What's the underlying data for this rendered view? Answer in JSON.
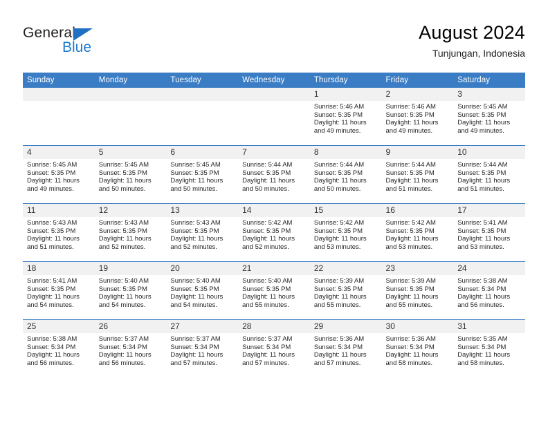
{
  "brand": {
    "name_part1": "General",
    "name_part2": "Blue",
    "accent_color": "#1f7bd0",
    "triangle_color": "#1f6fc4"
  },
  "header": {
    "title": "August 2024",
    "subtitle": "Tunjungan, Indonesia"
  },
  "theme": {
    "header_row_color": "#3b7dc4",
    "daynum_band_color": "#f1f1f1",
    "text_color": "#262626"
  },
  "weekday_headers": [
    "Sunday",
    "Monday",
    "Tuesday",
    "Wednesday",
    "Thursday",
    "Friday",
    "Saturday"
  ],
  "weeks": [
    [
      {
        "day": "",
        "sunrise": "",
        "sunset": "",
        "daylight_line1": "",
        "daylight_line2": "",
        "empty": true
      },
      {
        "day": "",
        "sunrise": "",
        "sunset": "",
        "daylight_line1": "",
        "daylight_line2": "",
        "empty": true
      },
      {
        "day": "",
        "sunrise": "",
        "sunset": "",
        "daylight_line1": "",
        "daylight_line2": "",
        "empty": true
      },
      {
        "day": "",
        "sunrise": "",
        "sunset": "",
        "daylight_line1": "",
        "daylight_line2": "",
        "empty": true
      },
      {
        "day": "1",
        "sunrise": "Sunrise: 5:46 AM",
        "sunset": "Sunset: 5:35 PM",
        "daylight_line1": "Daylight: 11 hours",
        "daylight_line2": "and 49 minutes.",
        "empty": false
      },
      {
        "day": "2",
        "sunrise": "Sunrise: 5:46 AM",
        "sunset": "Sunset: 5:35 PM",
        "daylight_line1": "Daylight: 11 hours",
        "daylight_line2": "and 49 minutes.",
        "empty": false
      },
      {
        "day": "3",
        "sunrise": "Sunrise: 5:45 AM",
        "sunset": "Sunset: 5:35 PM",
        "daylight_line1": "Daylight: 11 hours",
        "daylight_line2": "and 49 minutes.",
        "empty": false
      }
    ],
    [
      {
        "day": "4",
        "sunrise": "Sunrise: 5:45 AM",
        "sunset": "Sunset: 5:35 PM",
        "daylight_line1": "Daylight: 11 hours",
        "daylight_line2": "and 49 minutes.",
        "empty": false
      },
      {
        "day": "5",
        "sunrise": "Sunrise: 5:45 AM",
        "sunset": "Sunset: 5:35 PM",
        "daylight_line1": "Daylight: 11 hours",
        "daylight_line2": "and 50 minutes.",
        "empty": false
      },
      {
        "day": "6",
        "sunrise": "Sunrise: 5:45 AM",
        "sunset": "Sunset: 5:35 PM",
        "daylight_line1": "Daylight: 11 hours",
        "daylight_line2": "and 50 minutes.",
        "empty": false
      },
      {
        "day": "7",
        "sunrise": "Sunrise: 5:44 AM",
        "sunset": "Sunset: 5:35 PM",
        "daylight_line1": "Daylight: 11 hours",
        "daylight_line2": "and 50 minutes.",
        "empty": false
      },
      {
        "day": "8",
        "sunrise": "Sunrise: 5:44 AM",
        "sunset": "Sunset: 5:35 PM",
        "daylight_line1": "Daylight: 11 hours",
        "daylight_line2": "and 50 minutes.",
        "empty": false
      },
      {
        "day": "9",
        "sunrise": "Sunrise: 5:44 AM",
        "sunset": "Sunset: 5:35 PM",
        "daylight_line1": "Daylight: 11 hours",
        "daylight_line2": "and 51 minutes.",
        "empty": false
      },
      {
        "day": "10",
        "sunrise": "Sunrise: 5:44 AM",
        "sunset": "Sunset: 5:35 PM",
        "daylight_line1": "Daylight: 11 hours",
        "daylight_line2": "and 51 minutes.",
        "empty": false
      }
    ],
    [
      {
        "day": "11",
        "sunrise": "Sunrise: 5:43 AM",
        "sunset": "Sunset: 5:35 PM",
        "daylight_line1": "Daylight: 11 hours",
        "daylight_line2": "and 51 minutes.",
        "empty": false
      },
      {
        "day": "12",
        "sunrise": "Sunrise: 5:43 AM",
        "sunset": "Sunset: 5:35 PM",
        "daylight_line1": "Daylight: 11 hours",
        "daylight_line2": "and 52 minutes.",
        "empty": false
      },
      {
        "day": "13",
        "sunrise": "Sunrise: 5:43 AM",
        "sunset": "Sunset: 5:35 PM",
        "daylight_line1": "Daylight: 11 hours",
        "daylight_line2": "and 52 minutes.",
        "empty": false
      },
      {
        "day": "14",
        "sunrise": "Sunrise: 5:42 AM",
        "sunset": "Sunset: 5:35 PM",
        "daylight_line1": "Daylight: 11 hours",
        "daylight_line2": "and 52 minutes.",
        "empty": false
      },
      {
        "day": "15",
        "sunrise": "Sunrise: 5:42 AM",
        "sunset": "Sunset: 5:35 PM",
        "daylight_line1": "Daylight: 11 hours",
        "daylight_line2": "and 53 minutes.",
        "empty": false
      },
      {
        "day": "16",
        "sunrise": "Sunrise: 5:42 AM",
        "sunset": "Sunset: 5:35 PM",
        "daylight_line1": "Daylight: 11 hours",
        "daylight_line2": "and 53 minutes.",
        "empty": false
      },
      {
        "day": "17",
        "sunrise": "Sunrise: 5:41 AM",
        "sunset": "Sunset: 5:35 PM",
        "daylight_line1": "Daylight: 11 hours",
        "daylight_line2": "and 53 minutes.",
        "empty": false
      }
    ],
    [
      {
        "day": "18",
        "sunrise": "Sunrise: 5:41 AM",
        "sunset": "Sunset: 5:35 PM",
        "daylight_line1": "Daylight: 11 hours",
        "daylight_line2": "and 54 minutes.",
        "empty": false
      },
      {
        "day": "19",
        "sunrise": "Sunrise: 5:40 AM",
        "sunset": "Sunset: 5:35 PM",
        "daylight_line1": "Daylight: 11 hours",
        "daylight_line2": "and 54 minutes.",
        "empty": false
      },
      {
        "day": "20",
        "sunrise": "Sunrise: 5:40 AM",
        "sunset": "Sunset: 5:35 PM",
        "daylight_line1": "Daylight: 11 hours",
        "daylight_line2": "and 54 minutes.",
        "empty": false
      },
      {
        "day": "21",
        "sunrise": "Sunrise: 5:40 AM",
        "sunset": "Sunset: 5:35 PM",
        "daylight_line1": "Daylight: 11 hours",
        "daylight_line2": "and 55 minutes.",
        "empty": false
      },
      {
        "day": "22",
        "sunrise": "Sunrise: 5:39 AM",
        "sunset": "Sunset: 5:35 PM",
        "daylight_line1": "Daylight: 11 hours",
        "daylight_line2": "and 55 minutes.",
        "empty": false
      },
      {
        "day": "23",
        "sunrise": "Sunrise: 5:39 AM",
        "sunset": "Sunset: 5:35 PM",
        "daylight_line1": "Daylight: 11 hours",
        "daylight_line2": "and 55 minutes.",
        "empty": false
      },
      {
        "day": "24",
        "sunrise": "Sunrise: 5:38 AM",
        "sunset": "Sunset: 5:34 PM",
        "daylight_line1": "Daylight: 11 hours",
        "daylight_line2": "and 56 minutes.",
        "empty": false
      }
    ],
    [
      {
        "day": "25",
        "sunrise": "Sunrise: 5:38 AM",
        "sunset": "Sunset: 5:34 PM",
        "daylight_line1": "Daylight: 11 hours",
        "daylight_line2": "and 56 minutes.",
        "empty": false
      },
      {
        "day": "26",
        "sunrise": "Sunrise: 5:37 AM",
        "sunset": "Sunset: 5:34 PM",
        "daylight_line1": "Daylight: 11 hours",
        "daylight_line2": "and 56 minutes.",
        "empty": false
      },
      {
        "day": "27",
        "sunrise": "Sunrise: 5:37 AM",
        "sunset": "Sunset: 5:34 PM",
        "daylight_line1": "Daylight: 11 hours",
        "daylight_line2": "and 57 minutes.",
        "empty": false
      },
      {
        "day": "28",
        "sunrise": "Sunrise: 5:37 AM",
        "sunset": "Sunset: 5:34 PM",
        "daylight_line1": "Daylight: 11 hours",
        "daylight_line2": "and 57 minutes.",
        "empty": false
      },
      {
        "day": "29",
        "sunrise": "Sunrise: 5:36 AM",
        "sunset": "Sunset: 5:34 PM",
        "daylight_line1": "Daylight: 11 hours",
        "daylight_line2": "and 57 minutes.",
        "empty": false
      },
      {
        "day": "30",
        "sunrise": "Sunrise: 5:36 AM",
        "sunset": "Sunset: 5:34 PM",
        "daylight_line1": "Daylight: 11 hours",
        "daylight_line2": "and 58 minutes.",
        "empty": false
      },
      {
        "day": "31",
        "sunrise": "Sunrise: 5:35 AM",
        "sunset": "Sunset: 5:34 PM",
        "daylight_line1": "Daylight: 11 hours",
        "daylight_line2": "and 58 minutes.",
        "empty": false
      }
    ]
  ]
}
